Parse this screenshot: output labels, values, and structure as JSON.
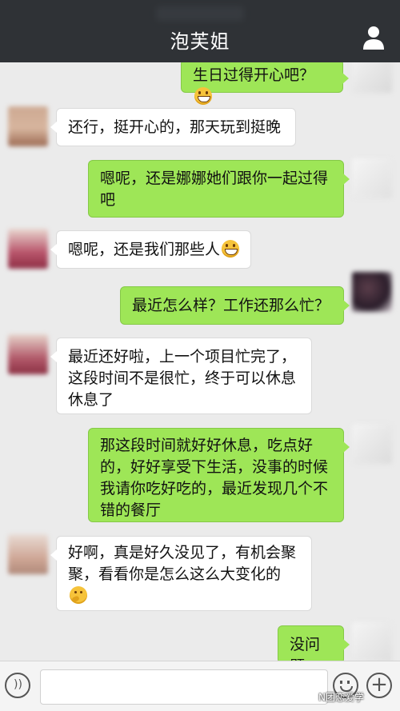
{
  "header": {
    "title": "泡芙姐"
  },
  "messages": [
    {
      "side": "out",
      "text": "生日过得开心吧？",
      "emoji": "grin"
    },
    {
      "side": "in",
      "text": "还行，挺开心的，那天玩到挺晚"
    },
    {
      "side": "out",
      "text": "嗯呢，还是娜娜她们跟你一起过得吧"
    },
    {
      "side": "in",
      "text": "嗯呢，还是我们那些人",
      "emoji": "grin"
    },
    {
      "side": "out",
      "text": "最近怎么样？工作还那么忙？"
    },
    {
      "side": "in",
      "text": "最近还好啦，上一个项目忙完了，这段时间不是很忙，终于可以休息休息了"
    },
    {
      "side": "out",
      "text": "那这段时间就好好休息，吃点好的，好好享受下生活，没事的时候我请你吃好吃的，最近发现几个不错的餐厅"
    },
    {
      "side": "in",
      "text": "好啊，真是好久没见了，有机会聚聚，看看你是怎么这么大变化的",
      "emoji": "think"
    },
    {
      "side": "out",
      "text": "没问题"
    }
  ],
  "watermark": "N团恋爱学",
  "colors": {
    "header": "#2f3236",
    "background": "#ebebeb",
    "outgoing_bubble": "#9ee657",
    "incoming_bubble": "#ffffff"
  },
  "icons": {
    "voice": "voice-icon",
    "emoji": "smiley-icon",
    "more": "plus-icon",
    "contact": "person-icon"
  }
}
